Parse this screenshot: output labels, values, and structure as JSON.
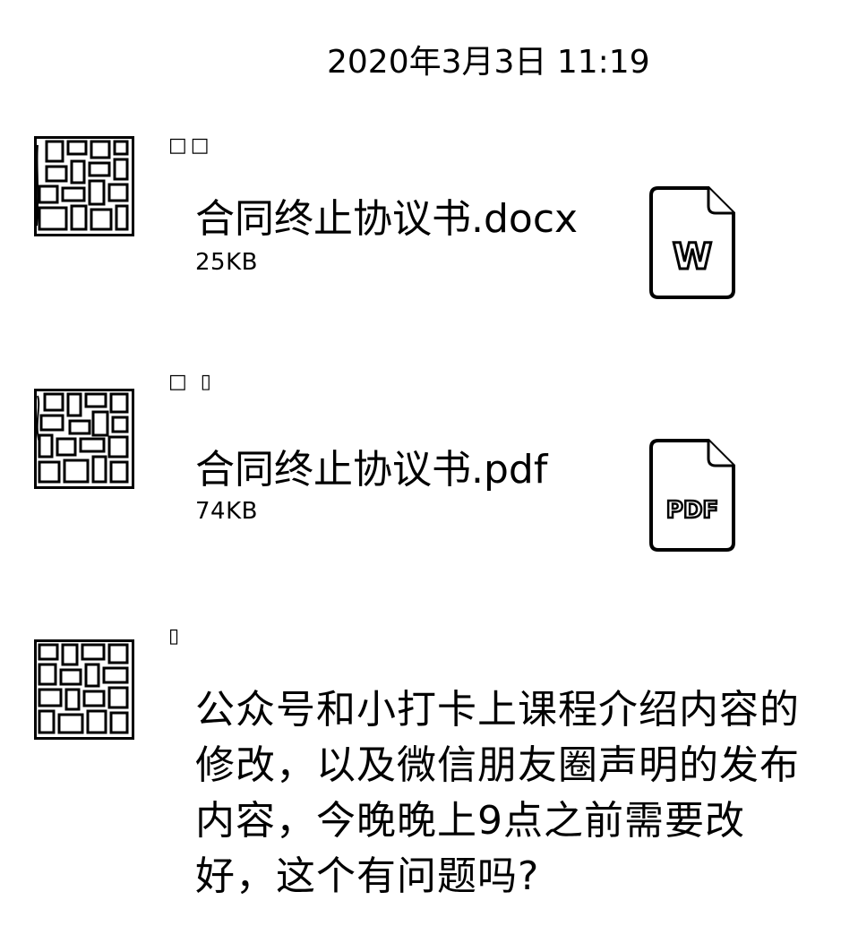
{
  "chat": {
    "timestamp": "2020年3月3日 11:19",
    "messages": [
      {
        "type": "file",
        "sender": "□□",
        "file_name": "合同终止协议书.docx",
        "file_size": "25KB",
        "file_icon": "word-file-icon",
        "icon_label": "W"
      },
      {
        "type": "file",
        "sender": "□ ▯",
        "file_name": "合同终止协议书.pdf",
        "file_size": "74KB",
        "file_icon": "pdf-file-icon",
        "icon_label": "PDF"
      },
      {
        "type": "text",
        "sender": "▯",
        "text": "公众号和小打卡上课程介绍内容的修改，以及微信朋友圈声明的发布内容，今晚晚上9点之前需要改好，这个有问题吗?"
      }
    ]
  }
}
